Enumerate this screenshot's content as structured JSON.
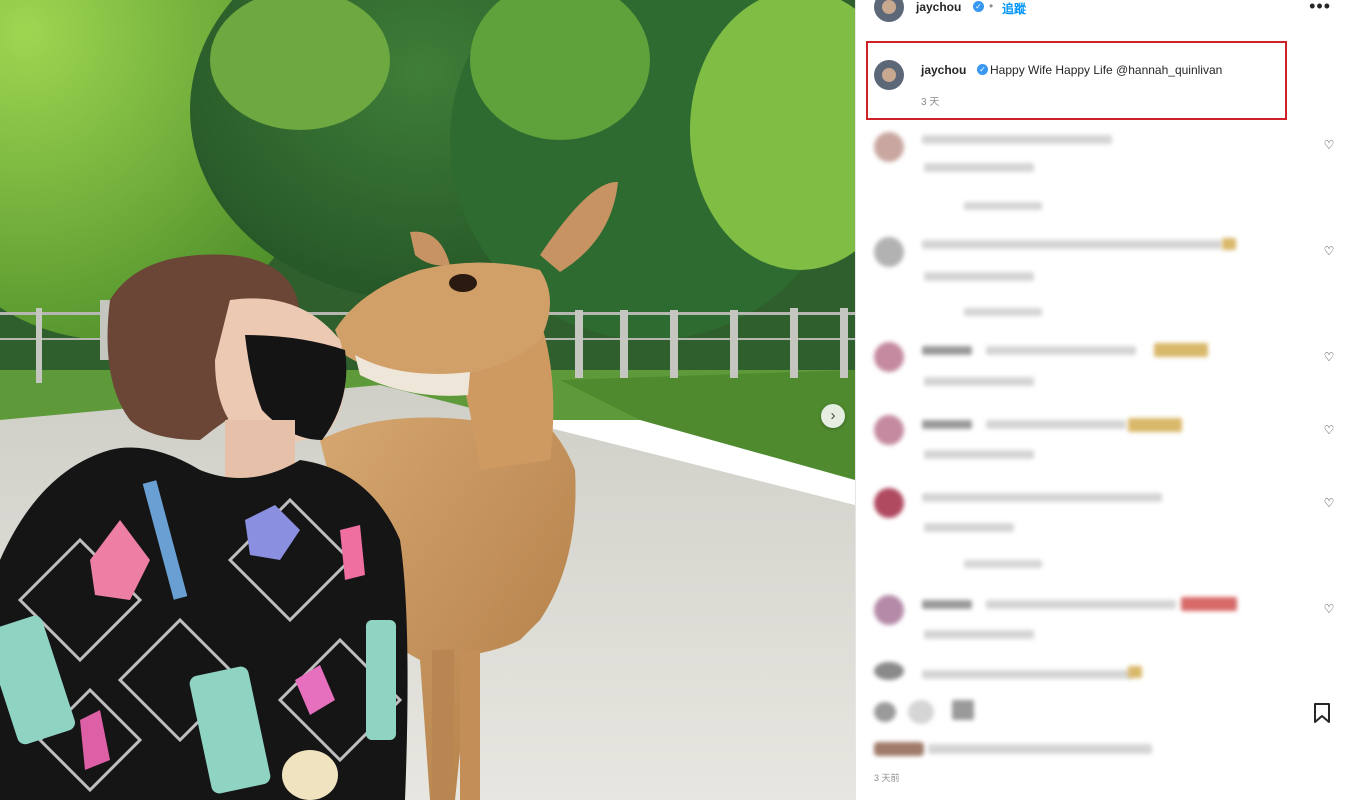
{
  "post": {
    "author": "jaychou",
    "follow_label": "追蹤",
    "more_label": "•••",
    "next_label": "›",
    "caption": {
      "username": "jaychou",
      "text": "Happy Wife Happy Life @hannah_quinlivan",
      "time": "3 天"
    },
    "footer_time": "3 天前"
  },
  "icons": {
    "verified": "verified-badge-icon",
    "heart": "heart-icon",
    "save": "bookmark-icon",
    "next": "chevron-right-icon"
  },
  "colors": {
    "highlight_border": "#d0202a",
    "verified": "#3897f0",
    "follow": "#0095f6"
  }
}
